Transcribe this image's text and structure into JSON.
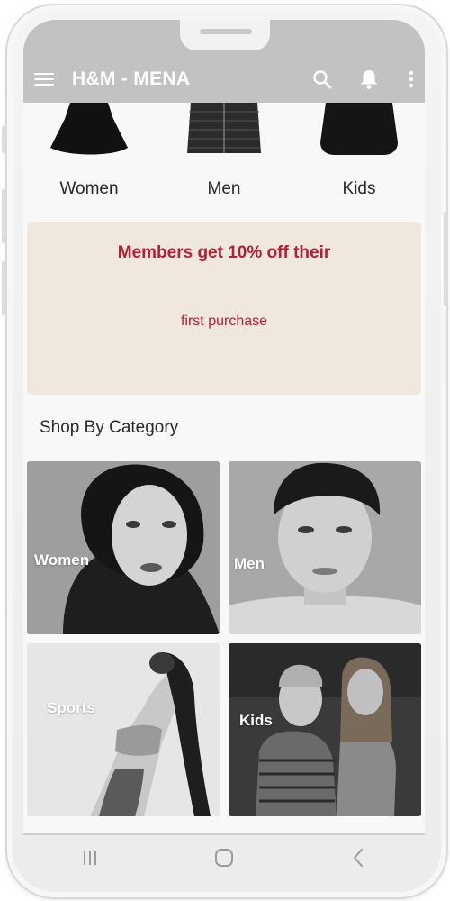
{
  "app_bar": {
    "title": "H&M - MENA",
    "menu_icon": "hamburger-menu-icon",
    "search_icon": "search-icon",
    "notification_icon": "bell-icon",
    "overflow_icon": "more-vertical-icon",
    "color": "#c2c2c2"
  },
  "top_categories": [
    {
      "label": "Women",
      "icon": "women-clothing-thumbnail"
    },
    {
      "label": "Men",
      "icon": "men-jacket-thumbnail"
    },
    {
      "label": "Kids",
      "icon": "kids-clothing-thumbnail"
    }
  ],
  "promo": {
    "headline": "Members get 10% off their",
    "subtext": "first purchase",
    "background": "#f0e8dd",
    "text_color": "#b32034"
  },
  "shop_by_category": {
    "title": "Shop By Category",
    "tiles": [
      {
        "label": "Women"
      },
      {
        "label": "Men"
      },
      {
        "label": "Sports"
      },
      {
        "label": "Kids"
      }
    ]
  },
  "system_nav": {
    "recents_icon": "recent-apps-icon",
    "home_icon": "home-icon",
    "back_icon": "back-icon"
  }
}
